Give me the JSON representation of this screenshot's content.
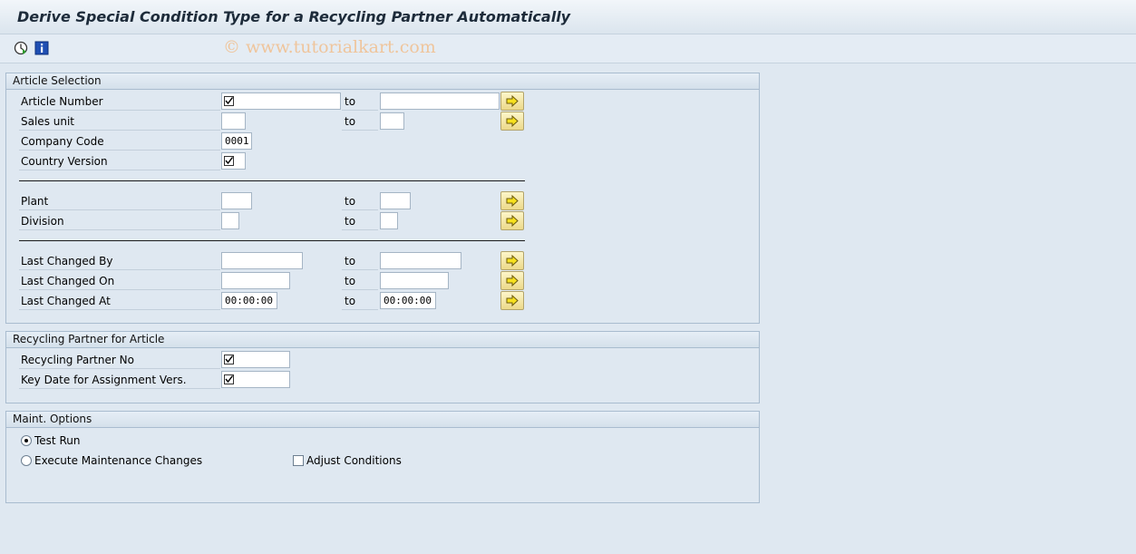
{
  "title": "Derive Special Condition Type for a Recycling Partner Automatically",
  "toolbar": {
    "execute_icon": "execute-clock-icon",
    "info_icon": "info-icon",
    "watermark": "© www.tutorialkart.com"
  },
  "article_selection": {
    "header": "Article Selection",
    "to_label": "to",
    "fields": {
      "article_number": {
        "label": "Article Number",
        "from": "",
        "to": ""
      },
      "sales_unit": {
        "label": "Sales unit",
        "from": "",
        "to": ""
      },
      "company_code": {
        "label": "Company Code",
        "value": "0001"
      },
      "country_version": {
        "label": "Country Version",
        "value": ""
      },
      "plant": {
        "label": "Plant",
        "from": "",
        "to": ""
      },
      "division": {
        "label": "Division",
        "from": "",
        "to": ""
      },
      "last_changed_by": {
        "label": "Last Changed By",
        "from": "",
        "to": ""
      },
      "last_changed_on": {
        "label": "Last Changed On",
        "from": "",
        "to": ""
      },
      "last_changed_at": {
        "label": "Last Changed At",
        "from": "00:00:00",
        "to": "00:00:00"
      }
    }
  },
  "recycling_partner": {
    "header": "Recycling Partner for Article",
    "fields": {
      "partner_no": {
        "label": "Recycling Partner No",
        "value": ""
      },
      "key_date": {
        "label": "Key Date for Assignment Vers.",
        "value": ""
      }
    }
  },
  "maint_options": {
    "header": "Maint. Options",
    "test_run": {
      "label": "Test Run",
      "selected": true
    },
    "execute_changes": {
      "label": "Execute Maintenance Changes",
      "selected": false
    },
    "adjust_conditions": {
      "label": "Adjust Conditions",
      "checked": false
    }
  },
  "colors": {
    "background": "#dfe8f1",
    "group_border": "#a9bccf",
    "select_button": "#f3e6a3"
  }
}
